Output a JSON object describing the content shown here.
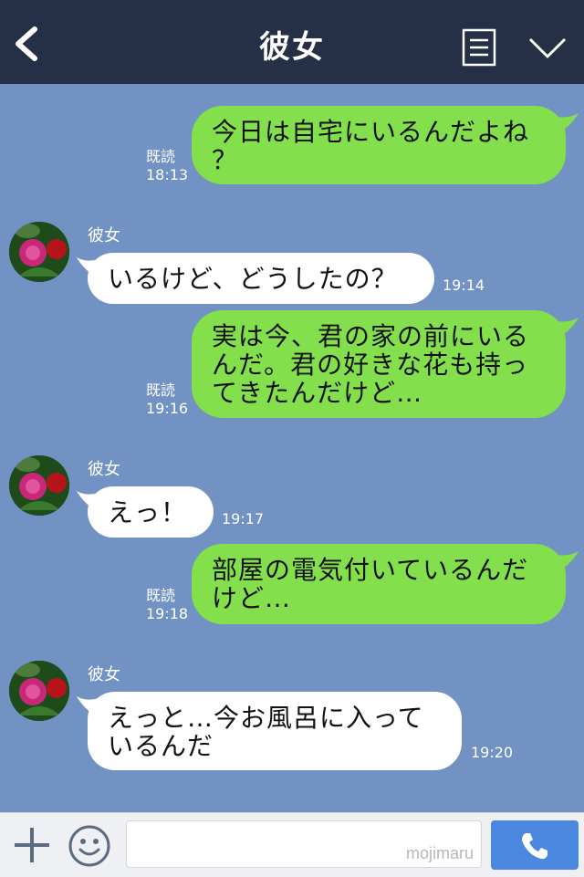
{
  "header": {
    "title": "彼女"
  },
  "messages": [
    {
      "type": "sent",
      "text": "今日は自宅にいるんだよね\n？",
      "read": "既読",
      "time": "18:13"
    },
    {
      "type": "received",
      "sender": "彼女",
      "text": "いるけど、どうしたの？",
      "time": "19:14"
    },
    {
      "type": "sent",
      "text": "実は今、君の家の前にいる\nんだ。君の好きな花も持っ\nてきたんだけど…",
      "read": "既読",
      "time": "19:16"
    },
    {
      "type": "received",
      "sender": "彼女",
      "text": "えっ！",
      "time": "19:17"
    },
    {
      "type": "sent",
      "text": "部屋の電気付いているんだ\nけど…",
      "read": "既読",
      "time": "19:18"
    },
    {
      "type": "received",
      "sender": "彼女",
      "text": "えっと…今お風呂に入って\nいるんだ",
      "time": "19:20"
    }
  ],
  "input": {
    "placeholder": "",
    "watermark": "mojimaru"
  },
  "colors": {
    "header": "#253046",
    "background": "#7192c2",
    "sent_bubble": "#83e04c",
    "received_bubble": "#ffffff",
    "call_button": "#4c88e0"
  },
  "icons": [
    "back-icon",
    "menu-icon",
    "chevron-down-icon",
    "plus-icon",
    "emoji-icon",
    "phone-icon"
  ]
}
